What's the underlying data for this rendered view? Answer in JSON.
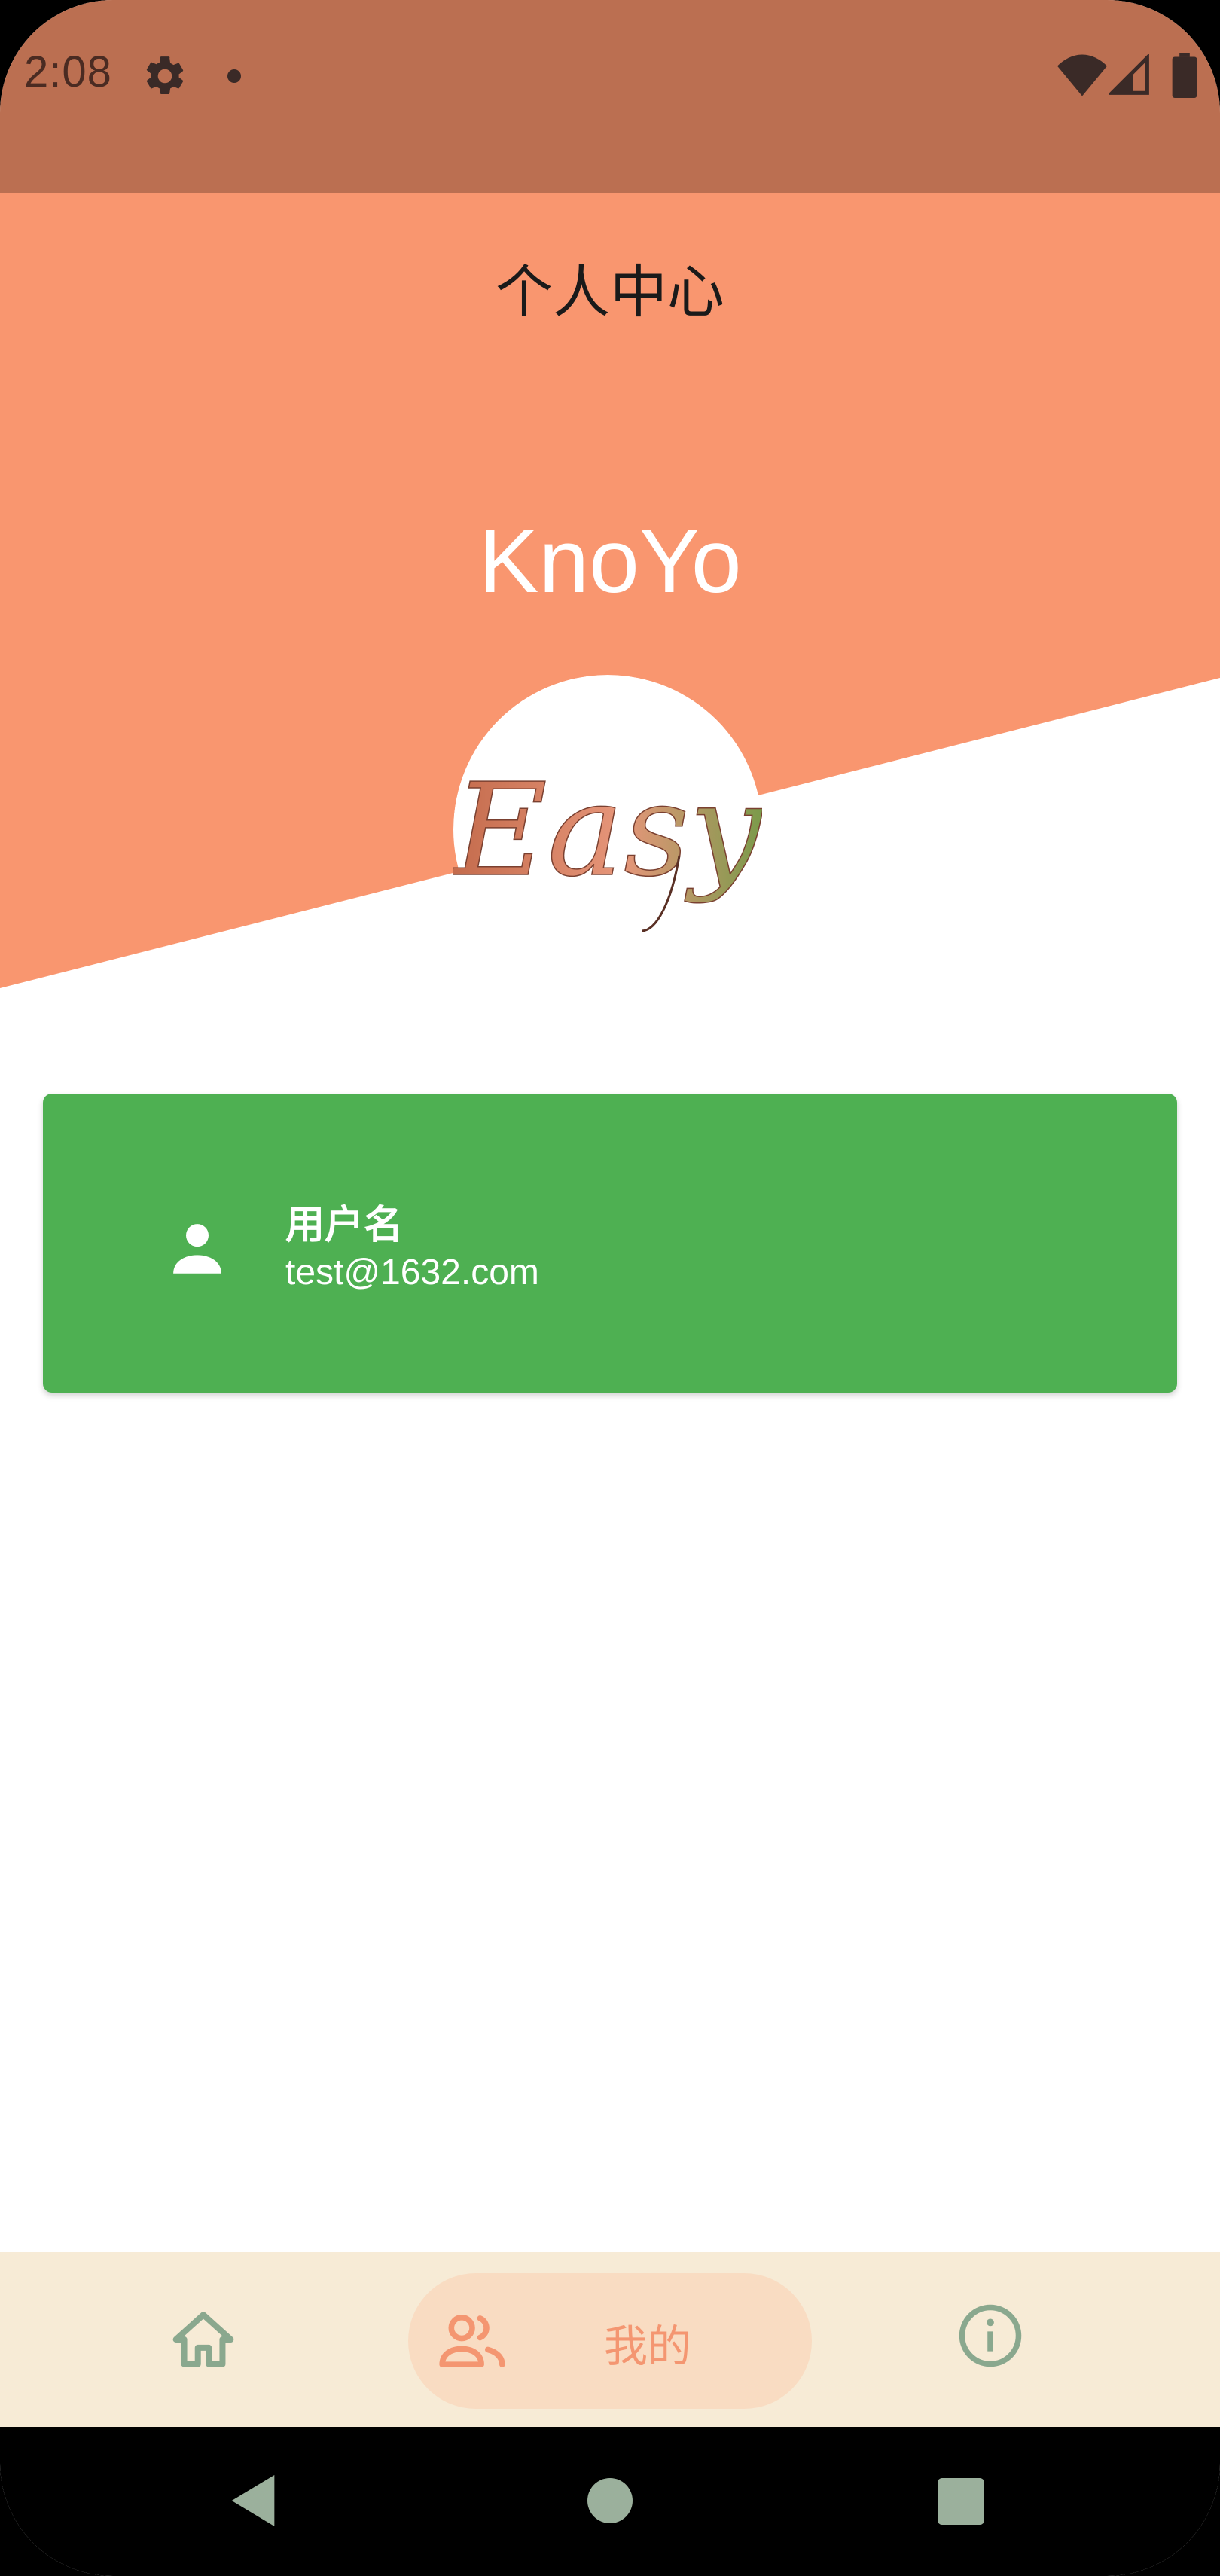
{
  "status_bar": {
    "time": "2:08",
    "icons": [
      "gear-icon",
      "notification-dot",
      "wifi-icon",
      "signal-icon",
      "battery-icon"
    ]
  },
  "header": {
    "title": "个人中心",
    "brand_name": "KnoYo",
    "logo_text": "Easy"
  },
  "user_card": {
    "name": "用户名",
    "email": "test@1632.com",
    "icon": "person-icon"
  },
  "bottom_nav": {
    "items": [
      {
        "id": "home",
        "icon": "home-icon",
        "label": "",
        "active": false
      },
      {
        "id": "mine",
        "icon": "people-icon",
        "label": "我的",
        "active": true
      },
      {
        "id": "about",
        "icon": "info-icon",
        "label": "",
        "active": false
      }
    ]
  },
  "system_nav": {
    "items": [
      "back-icon",
      "home-circle-icon",
      "recents-icon"
    ]
  },
  "colors": {
    "status_bar": "#bb6f51",
    "header_bg": "#f9966f",
    "card_bg": "#4eb052",
    "nav_bg": "#f7ebd6",
    "nav_active_pill": "#f9dcc2",
    "nav_active_fg": "#f49671",
    "nav_inactive_fg": "#8aa88e"
  }
}
